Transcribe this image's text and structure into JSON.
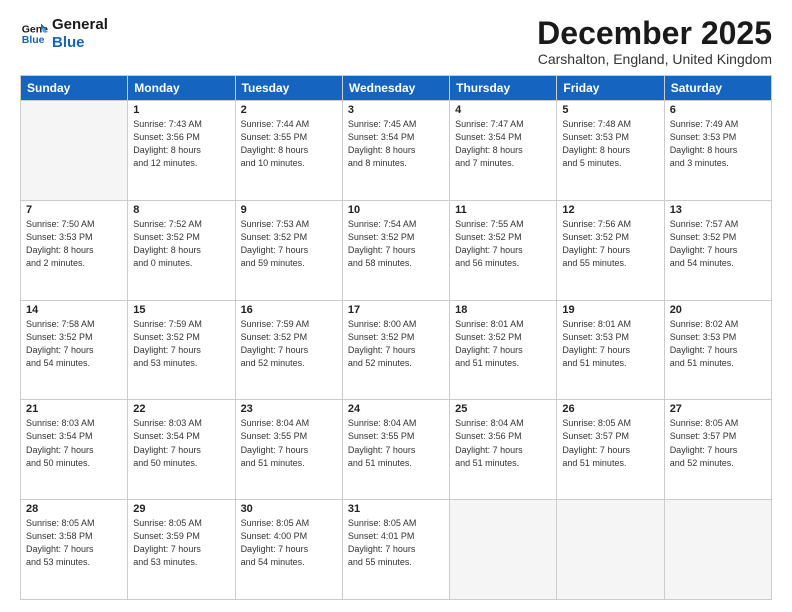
{
  "logo": {
    "line1": "General",
    "line2": "Blue"
  },
  "title": "December 2025",
  "subtitle": "Carshalton, England, United Kingdom",
  "weekdays": [
    "Sunday",
    "Monday",
    "Tuesday",
    "Wednesday",
    "Thursday",
    "Friday",
    "Saturday"
  ],
  "weeks": [
    [
      {
        "day": "",
        "info": ""
      },
      {
        "day": "1",
        "info": "Sunrise: 7:43 AM\nSunset: 3:56 PM\nDaylight: 8 hours\nand 12 minutes."
      },
      {
        "day": "2",
        "info": "Sunrise: 7:44 AM\nSunset: 3:55 PM\nDaylight: 8 hours\nand 10 minutes."
      },
      {
        "day": "3",
        "info": "Sunrise: 7:45 AM\nSunset: 3:54 PM\nDaylight: 8 hours\nand 8 minutes."
      },
      {
        "day": "4",
        "info": "Sunrise: 7:47 AM\nSunset: 3:54 PM\nDaylight: 8 hours\nand 7 minutes."
      },
      {
        "day": "5",
        "info": "Sunrise: 7:48 AM\nSunset: 3:53 PM\nDaylight: 8 hours\nand 5 minutes."
      },
      {
        "day": "6",
        "info": "Sunrise: 7:49 AM\nSunset: 3:53 PM\nDaylight: 8 hours\nand 3 minutes."
      }
    ],
    [
      {
        "day": "7",
        "info": "Sunrise: 7:50 AM\nSunset: 3:53 PM\nDaylight: 8 hours\nand 2 minutes."
      },
      {
        "day": "8",
        "info": "Sunrise: 7:52 AM\nSunset: 3:52 PM\nDaylight: 8 hours\nand 0 minutes."
      },
      {
        "day": "9",
        "info": "Sunrise: 7:53 AM\nSunset: 3:52 PM\nDaylight: 7 hours\nand 59 minutes."
      },
      {
        "day": "10",
        "info": "Sunrise: 7:54 AM\nSunset: 3:52 PM\nDaylight: 7 hours\nand 58 minutes."
      },
      {
        "day": "11",
        "info": "Sunrise: 7:55 AM\nSunset: 3:52 PM\nDaylight: 7 hours\nand 56 minutes."
      },
      {
        "day": "12",
        "info": "Sunrise: 7:56 AM\nSunset: 3:52 PM\nDaylight: 7 hours\nand 55 minutes."
      },
      {
        "day": "13",
        "info": "Sunrise: 7:57 AM\nSunset: 3:52 PM\nDaylight: 7 hours\nand 54 minutes."
      }
    ],
    [
      {
        "day": "14",
        "info": "Sunrise: 7:58 AM\nSunset: 3:52 PM\nDaylight: 7 hours\nand 54 minutes."
      },
      {
        "day": "15",
        "info": "Sunrise: 7:59 AM\nSunset: 3:52 PM\nDaylight: 7 hours\nand 53 minutes."
      },
      {
        "day": "16",
        "info": "Sunrise: 7:59 AM\nSunset: 3:52 PM\nDaylight: 7 hours\nand 52 minutes."
      },
      {
        "day": "17",
        "info": "Sunrise: 8:00 AM\nSunset: 3:52 PM\nDaylight: 7 hours\nand 52 minutes."
      },
      {
        "day": "18",
        "info": "Sunrise: 8:01 AM\nSunset: 3:52 PM\nDaylight: 7 hours\nand 51 minutes."
      },
      {
        "day": "19",
        "info": "Sunrise: 8:01 AM\nSunset: 3:53 PM\nDaylight: 7 hours\nand 51 minutes."
      },
      {
        "day": "20",
        "info": "Sunrise: 8:02 AM\nSunset: 3:53 PM\nDaylight: 7 hours\nand 51 minutes."
      }
    ],
    [
      {
        "day": "21",
        "info": "Sunrise: 8:03 AM\nSunset: 3:54 PM\nDaylight: 7 hours\nand 50 minutes."
      },
      {
        "day": "22",
        "info": "Sunrise: 8:03 AM\nSunset: 3:54 PM\nDaylight: 7 hours\nand 50 minutes."
      },
      {
        "day": "23",
        "info": "Sunrise: 8:04 AM\nSunset: 3:55 PM\nDaylight: 7 hours\nand 51 minutes."
      },
      {
        "day": "24",
        "info": "Sunrise: 8:04 AM\nSunset: 3:55 PM\nDaylight: 7 hours\nand 51 minutes."
      },
      {
        "day": "25",
        "info": "Sunrise: 8:04 AM\nSunset: 3:56 PM\nDaylight: 7 hours\nand 51 minutes."
      },
      {
        "day": "26",
        "info": "Sunrise: 8:05 AM\nSunset: 3:57 PM\nDaylight: 7 hours\nand 51 minutes."
      },
      {
        "day": "27",
        "info": "Sunrise: 8:05 AM\nSunset: 3:57 PM\nDaylight: 7 hours\nand 52 minutes."
      }
    ],
    [
      {
        "day": "28",
        "info": "Sunrise: 8:05 AM\nSunset: 3:58 PM\nDaylight: 7 hours\nand 53 minutes."
      },
      {
        "day": "29",
        "info": "Sunrise: 8:05 AM\nSunset: 3:59 PM\nDaylight: 7 hours\nand 53 minutes."
      },
      {
        "day": "30",
        "info": "Sunrise: 8:05 AM\nSunset: 4:00 PM\nDaylight: 7 hours\nand 54 minutes."
      },
      {
        "day": "31",
        "info": "Sunrise: 8:05 AM\nSunset: 4:01 PM\nDaylight: 7 hours\nand 55 minutes."
      },
      {
        "day": "",
        "info": ""
      },
      {
        "day": "",
        "info": ""
      },
      {
        "day": "",
        "info": ""
      }
    ]
  ]
}
